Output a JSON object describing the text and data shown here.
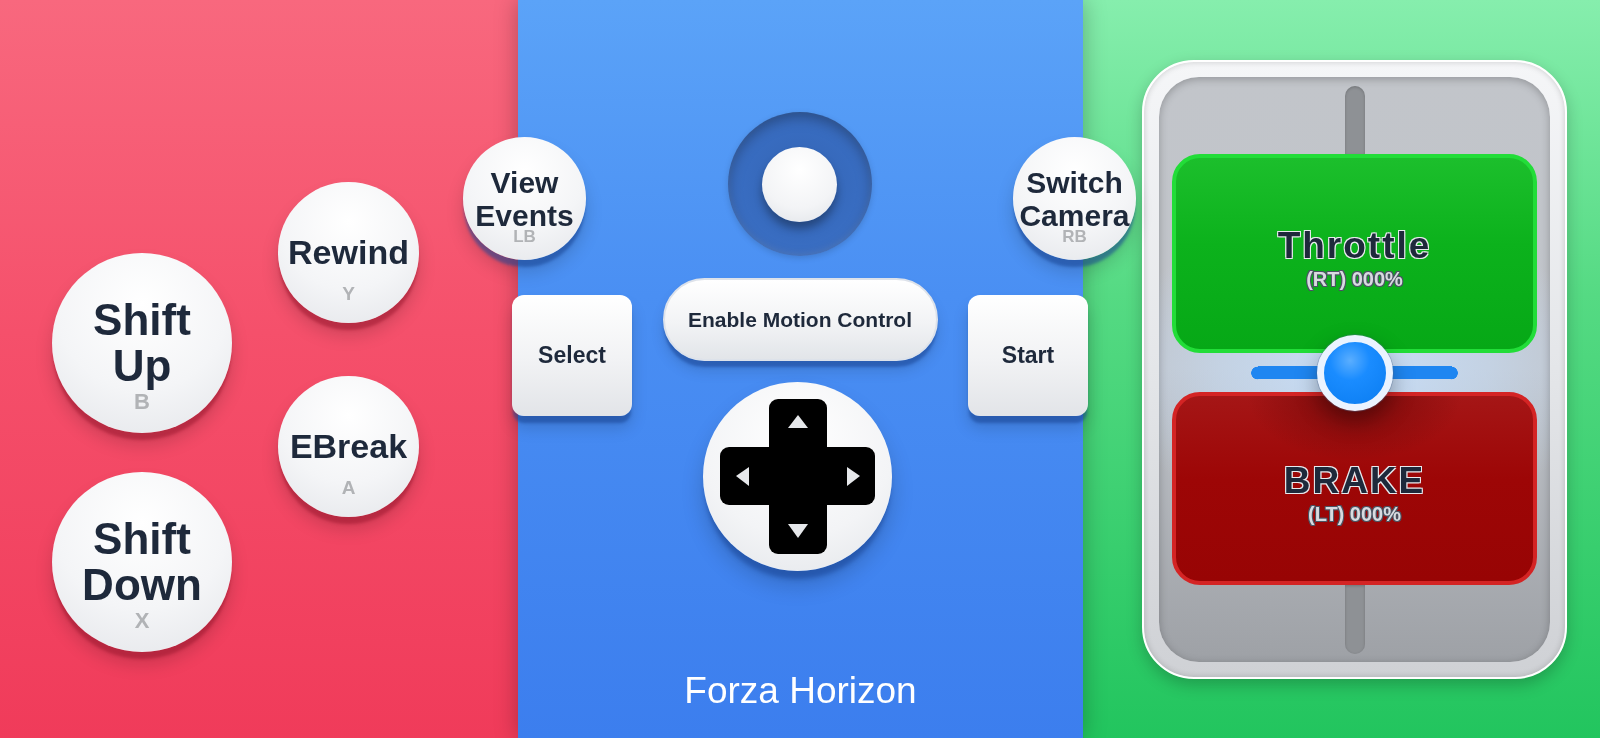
{
  "left_panel": {
    "shift_buttons": [
      {
        "label": "Shift Up",
        "key": "B"
      },
      {
        "label": "Shift Down",
        "key": "X"
      }
    ],
    "action_buttons": [
      {
        "label": "Rewind",
        "key": "Y"
      },
      {
        "label": "EBreak",
        "key": "A"
      }
    ]
  },
  "center_panel": {
    "bumpers": [
      {
        "label": "View Events",
        "key": "LB"
      },
      {
        "label": "Switch Camera",
        "key": "RB"
      }
    ],
    "select_button": "Select",
    "motion_button": "Enable Motion Control",
    "start_button": "Start",
    "title": "Forza Horizon"
  },
  "right_panel": {
    "triggers": [
      {
        "kind": "throttle",
        "label": "Throttle",
        "reading": "(RT) 000%"
      },
      {
        "kind": "brake",
        "label": "BRAKE",
        "reading": "(LT) 000%"
      }
    ],
    "steering": {
      "level": 0.5
    }
  }
}
